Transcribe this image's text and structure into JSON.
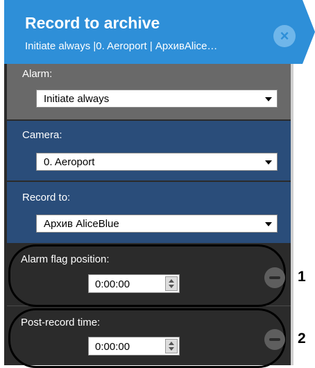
{
  "header": {
    "title": "Record to archive",
    "subtitle": "Initiate always |0. Aeroport | АрхивAlice…",
    "close_icon": "×"
  },
  "alarm": {
    "label": "Alarm:",
    "value": "Initiate always"
  },
  "camera": {
    "label": "Camera:",
    "value": "0. Aeroport"
  },
  "record_to": {
    "label": "Record to:",
    "value": "Архив AliceBlue"
  },
  "alarm_flag_position": {
    "label": "Alarm flag position:",
    "value": "0:00:00"
  },
  "post_record_time": {
    "label": "Post-record time:",
    "value": "0:00:00"
  },
  "callouts": [
    "1",
    "2"
  ]
}
